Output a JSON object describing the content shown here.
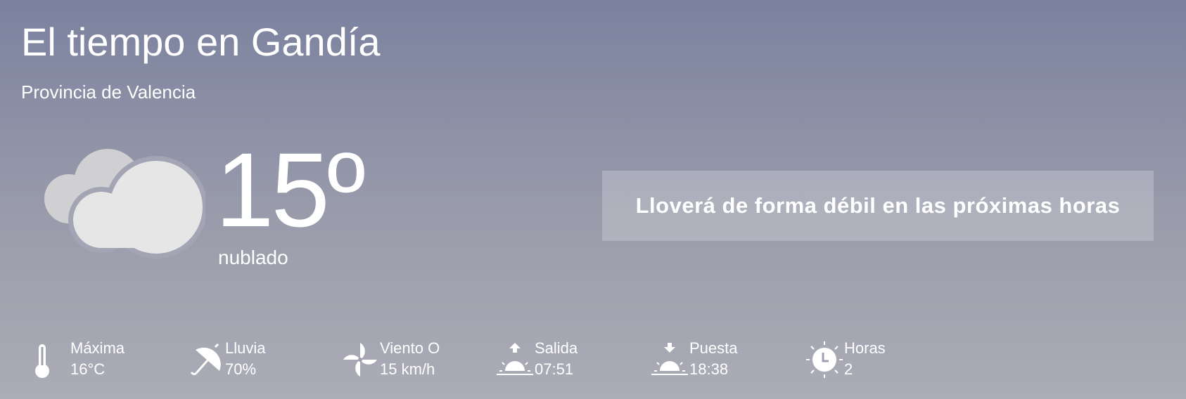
{
  "header": {
    "title": "El tiempo en Gandía",
    "subtitle": "Provincia de Valencia"
  },
  "current": {
    "icon": "cloud-icon",
    "temperature": "15º",
    "condition": "nublado"
  },
  "alert": {
    "text": "Lloverá de forma débil en las próximas horas"
  },
  "stats": [
    {
      "icon": "thermometer-icon",
      "label": "Máxima",
      "value": "16°C"
    },
    {
      "icon": "umbrella-icon",
      "label": "Lluvia",
      "value": "70%"
    },
    {
      "icon": "wind-icon",
      "label": "Viento O",
      "value": "15 km/h"
    },
    {
      "icon": "sunrise-icon",
      "label": "Salida",
      "value": "07:51"
    },
    {
      "icon": "sunset-icon",
      "label": "Puesta",
      "value": "18:38"
    },
    {
      "icon": "sun-clock-icon",
      "label": "Horas",
      "value": "2"
    }
  ]
}
